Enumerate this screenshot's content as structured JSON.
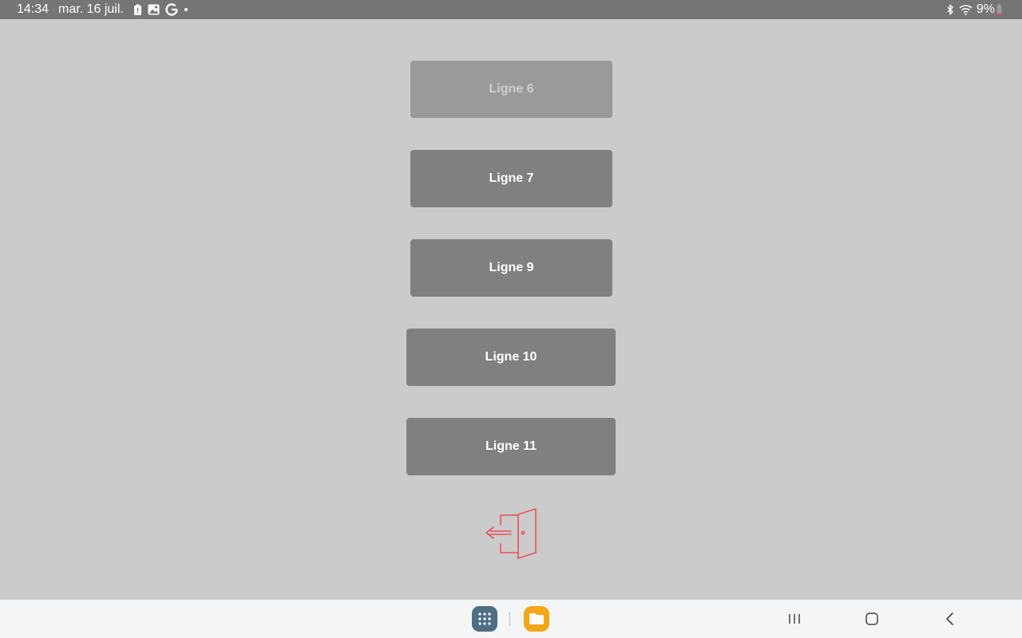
{
  "status_bar": {
    "time": "14:34",
    "date": "mar. 16 juil.",
    "left_icons": [
      "battery-alert-icon",
      "gallery-icon",
      "google-icon",
      "dot-icon"
    ],
    "right_icons": [
      "bluetooth-icon",
      "wifi-icon",
      "battery-icon"
    ],
    "battery": "9%"
  },
  "lines": [
    {
      "label": "Ligne 6",
      "enabled": false
    },
    {
      "label": "Ligne 7",
      "enabled": true
    },
    {
      "label": "Ligne 9",
      "enabled": true
    },
    {
      "label": "Ligne 10",
      "enabled": true
    },
    {
      "label": "Ligne 11",
      "enabled": true
    }
  ],
  "exit": {
    "icon": "exit-door-icon",
    "color": "#e8505b"
  },
  "nav_bar": {
    "dock": [
      "app-drawer-icon",
      "files-icon"
    ],
    "keys": [
      "recents-icon",
      "home-icon",
      "back-icon"
    ]
  },
  "colors": {
    "background": "#cbcbcb",
    "button": "#808080",
    "button_disabled": "#9a9a9a",
    "status_bar": "#757575",
    "accent_exit": "#e8505b"
  }
}
